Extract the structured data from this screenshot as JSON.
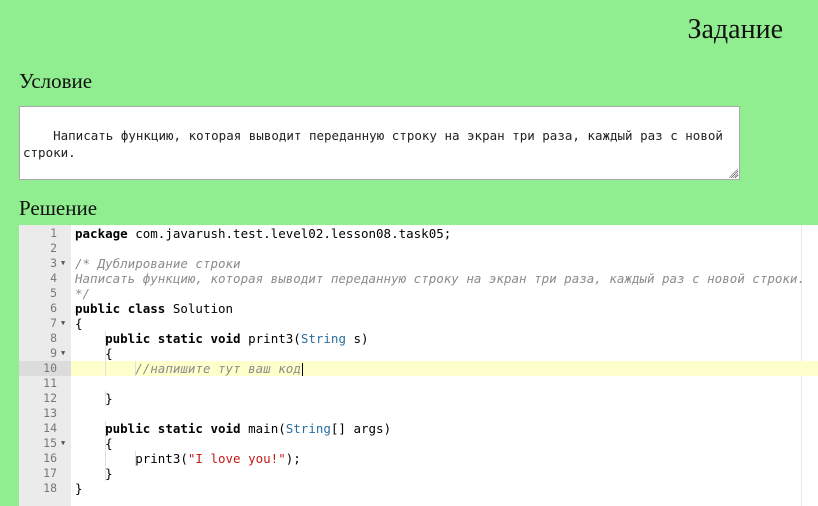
{
  "header": {
    "task_title": "Задание"
  },
  "condition": {
    "title": "Условие",
    "text": "Написать функцию, которая выводит переданную строку на экран три раза, каждый раз с новой строки."
  },
  "solution": {
    "title": "Решение",
    "active_line": 10,
    "lines": [
      {
        "n": "1",
        "fold": false,
        "tokens": [
          {
            "t": "kw",
            "v": "package"
          },
          {
            "t": "plain",
            "v": " com.javarush.test.level02.lesson08.task05;"
          }
        ]
      },
      {
        "n": "2",
        "fold": false,
        "tokens": []
      },
      {
        "n": "3",
        "fold": true,
        "tokens": [
          {
            "t": "comment",
            "v": "/* Дублирование строки"
          }
        ]
      },
      {
        "n": "4",
        "fold": false,
        "tokens": [
          {
            "t": "comment",
            "v": "Написать функцию, которая выводит переданную строку на экран три раза, каждый раз с новой строки."
          }
        ]
      },
      {
        "n": "5",
        "fold": false,
        "tokens": [
          {
            "t": "comment",
            "v": "*/"
          }
        ]
      },
      {
        "n": "6",
        "fold": false,
        "tokens": [
          {
            "t": "kw",
            "v": "public"
          },
          {
            "t": "plain",
            "v": " "
          },
          {
            "t": "kw",
            "v": "class"
          },
          {
            "t": "plain",
            "v": " Solution"
          }
        ]
      },
      {
        "n": "7",
        "fold": true,
        "tokens": [
          {
            "t": "plain",
            "v": "{"
          }
        ]
      },
      {
        "n": "8",
        "fold": false,
        "tokens": [
          {
            "t": "plain",
            "v": "    "
          },
          {
            "t": "kw",
            "v": "public"
          },
          {
            "t": "plain",
            "v": " "
          },
          {
            "t": "kw",
            "v": "static"
          },
          {
            "t": "plain",
            "v": " "
          },
          {
            "t": "kw",
            "v": "void"
          },
          {
            "t": "plain",
            "v": " print3("
          },
          {
            "t": "type",
            "v": "String"
          },
          {
            "t": "plain",
            "v": " s)"
          }
        ]
      },
      {
        "n": "9",
        "fold": true,
        "tokens": [
          {
            "t": "plain",
            "v": "    {"
          }
        ]
      },
      {
        "n": "10",
        "fold": false,
        "tokens": [
          {
            "t": "plain",
            "v": "        "
          },
          {
            "t": "comment",
            "v": "//напишите тут ваш код"
          }
        ]
      },
      {
        "n": "11",
        "fold": false,
        "tokens": []
      },
      {
        "n": "12",
        "fold": false,
        "tokens": [
          {
            "t": "plain",
            "v": "    }"
          }
        ]
      },
      {
        "n": "13",
        "fold": false,
        "tokens": []
      },
      {
        "n": "14",
        "fold": false,
        "tokens": [
          {
            "t": "plain",
            "v": "    "
          },
          {
            "t": "kw",
            "v": "public"
          },
          {
            "t": "plain",
            "v": " "
          },
          {
            "t": "kw",
            "v": "static"
          },
          {
            "t": "plain",
            "v": " "
          },
          {
            "t": "kw",
            "v": "void"
          },
          {
            "t": "plain",
            "v": " main("
          },
          {
            "t": "type",
            "v": "String"
          },
          {
            "t": "plain",
            "v": "[] args)"
          }
        ]
      },
      {
        "n": "15",
        "fold": true,
        "tokens": [
          {
            "t": "plain",
            "v": "    {"
          }
        ]
      },
      {
        "n": "16",
        "fold": false,
        "tokens": [
          {
            "t": "plain",
            "v": "        print3("
          },
          {
            "t": "str",
            "v": "\"I love you!\""
          },
          {
            "t": "plain",
            "v": ");"
          }
        ]
      },
      {
        "n": "17",
        "fold": false,
        "tokens": [
          {
            "t": "plain",
            "v": "    }"
          }
        ]
      },
      {
        "n": "18",
        "fold": false,
        "tokens": [
          {
            "t": "plain",
            "v": "}"
          }
        ]
      }
    ]
  },
  "colors": {
    "page_background": "#90ee90",
    "active_line": "#ffffcc",
    "type": "#2a6f9e",
    "string": "#c41a16",
    "comment": "#8c8c8c"
  },
  "icons": {
    "fold": "fold-arrow-icon",
    "resize": "resize-grip-icon"
  }
}
